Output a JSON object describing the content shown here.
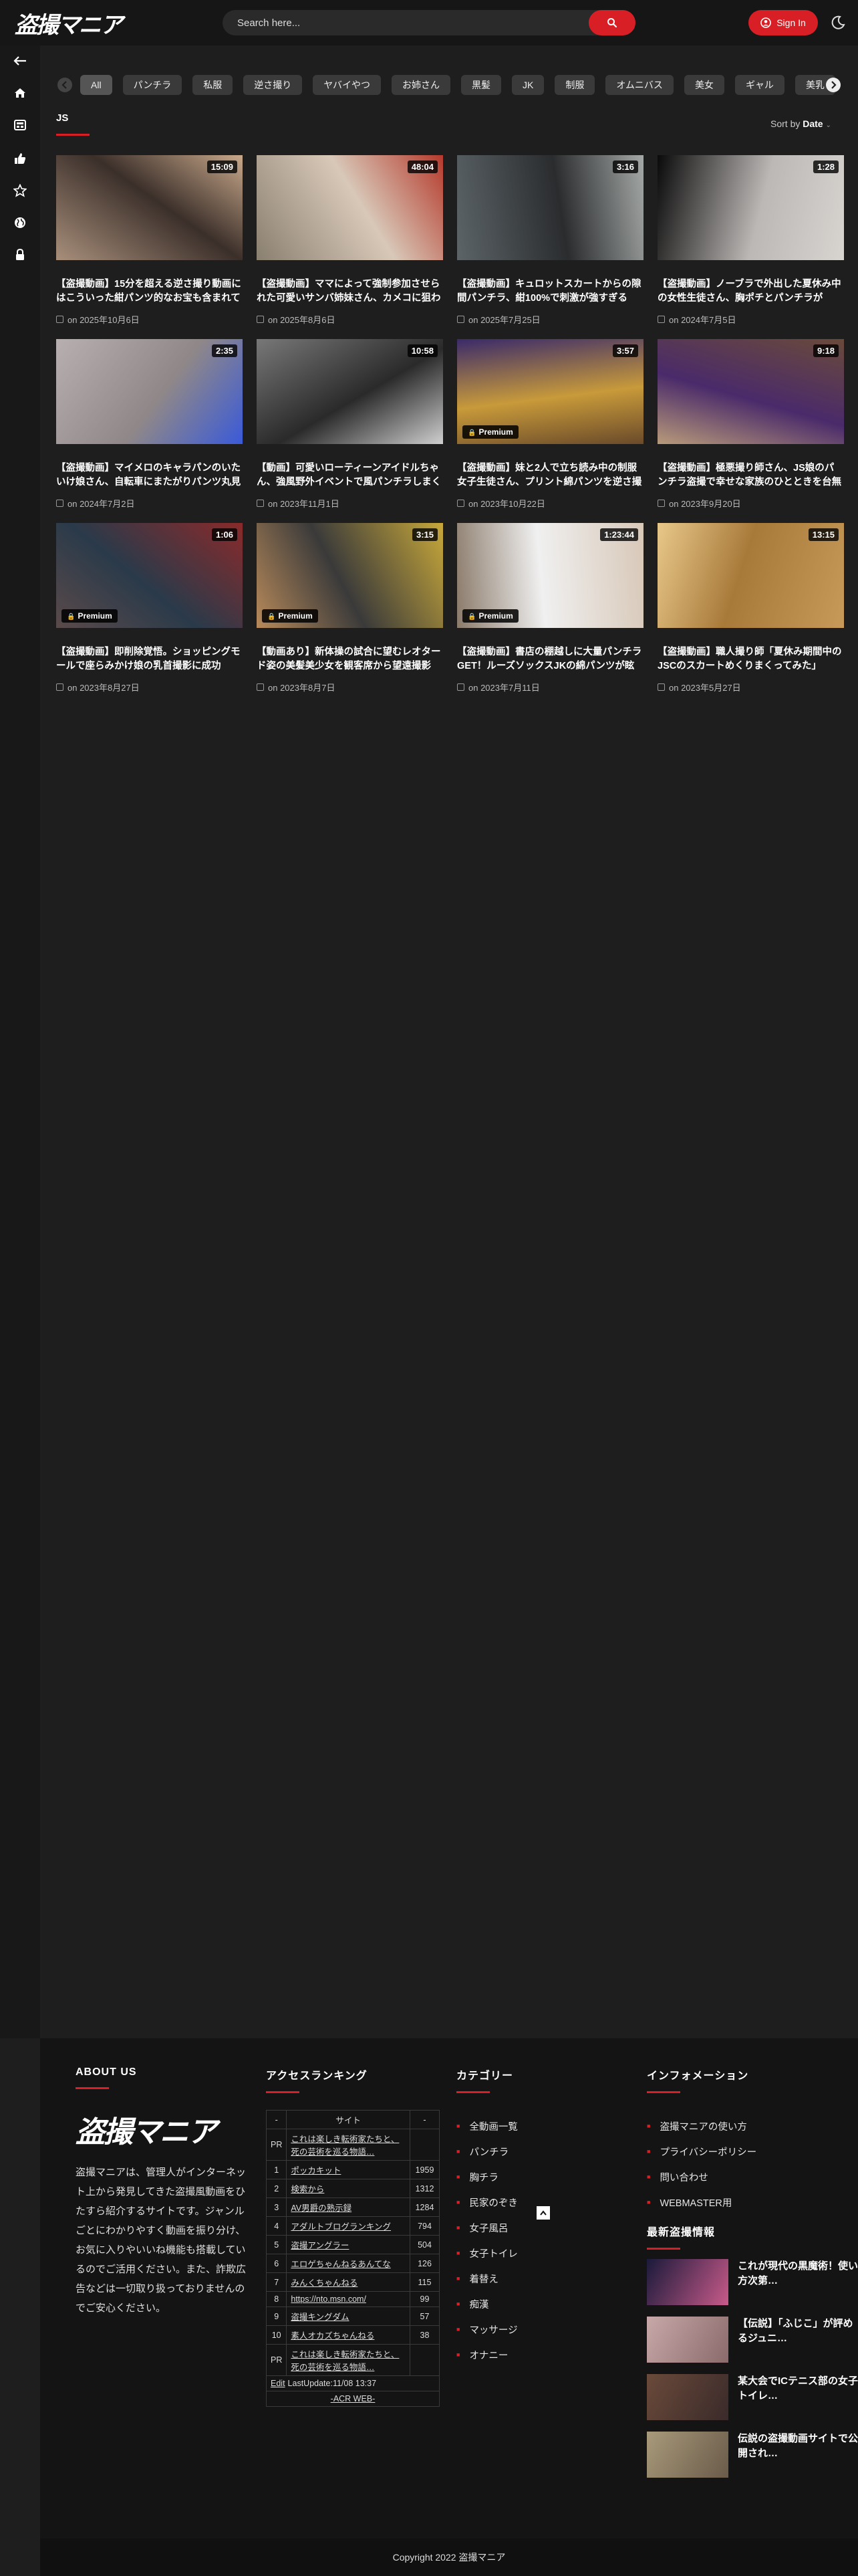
{
  "header": {
    "logo": "盗撮マニア",
    "search_placeholder": "Search here...",
    "signin_label": "Sign In"
  },
  "sidebar": {
    "items": [
      "back-arrow-icon",
      "home-icon",
      "grid-icon",
      "thumbs-up-icon",
      "star-icon",
      "globe-icon",
      "lock-icon"
    ]
  },
  "filters": {
    "chips": [
      "All",
      "パンチラ",
      "私服",
      "逆さ撮り",
      "ヤバイやつ",
      "お姉さん",
      "黒髪",
      "JK",
      "制服",
      "オムニバス",
      "美女",
      "ギャル",
      "美乳"
    ]
  },
  "page": {
    "title": "JS",
    "sort_label": "Sort by",
    "sort_value": "Date"
  },
  "videos": [
    {
      "title": "【盗撮動画】15分を超える逆さ撮り動画にはこういった紺パンツ的なお宝も含まれています",
      "date": "on 2025年10月6日",
      "duration": "15:09",
      "premium": false,
      "colors": [
        "#a88f7b",
        "#3b2f2a",
        "#c9a98b"
      ]
    },
    {
      "title": "【盗撮動画】ママによって強制参加させられた可愛いサンバ姉妹さん、カメコに狙われ",
      "date": "on 2025年8月6日",
      "duration": "48:04",
      "premium": false,
      "colors": [
        "#8a8070",
        "#d8c8b8",
        "#b53a2c"
      ]
    },
    {
      "title": "【盗撮動画】キュロットスカートからの隙間パンチラ、紺100%で刺激が強すぎる",
      "date": "on 2025年7月25日",
      "duration": "3:16",
      "premium": false,
      "colors": [
        "#5c6468",
        "#2a2c2e",
        "#a4a8a6"
      ]
    },
    {
      "title": "【盗撮動画】ノーブラで外出した夏休み中の女性生徒さん、胸ポチとパンチラが",
      "date": "on 2024年7月5日",
      "duration": "1:28",
      "premium": false,
      "colors": [
        "#0a0a0a",
        "#bcb8b6",
        "#d8d4d0"
      ]
    },
    {
      "title": "【盗撮動画】マイメロのキャラパンのいたいけ娘さん、自転車にまたがりパンツ丸見え",
      "date": "on 2024年7月2日",
      "duration": "2:35",
      "premium": false,
      "colors": [
        "#b8b0b0",
        "#908888",
        "#3a5ad8"
      ]
    },
    {
      "title": "【動画】可愛いローティーンアイドルちゃん、強風野外イベントで風パンチラしまくり",
      "date": "on 2023年11月1日",
      "duration": "10:58",
      "premium": false,
      "colors": [
        "#787878",
        "#2a2a2a",
        "#cfcfcf"
      ]
    },
    {
      "title": "【盗撮動画】妹と2人で立ち読み中の制服女子生徒さん、プリント綿パンツを逆さ撮り",
      "date": "on 2023年10月22日",
      "duration": "3:57",
      "premium": true,
      "colors": [
        "#3a2a6a",
        "#c89a3a",
        "#6a4a2a"
      ]
    },
    {
      "title": "【盗撮動画】極悪撮り師さん、JS娘のパンチラ盗撮で幸せな家族のひとときを台無しに",
      "date": "on 2023年9月20日",
      "duration": "9:18",
      "premium": false,
      "colors": [
        "#6a4a3a",
        "#4a2a6a",
        "#b89a7a"
      ]
    },
    {
      "title": "【盗撮動画】即削除覚悟。ショッピングモールで座らみかけ娘の乳首撮影に成功",
      "date": "on 2023年8月27日",
      "duration": "1:06",
      "premium": true,
      "colors": [
        "#8a2a2a",
        "#2a3a4a",
        "#5a4a4a"
      ]
    },
    {
      "title": "【動画あり】新体操の試合に望むレオタード姿の美髪美少女を観客席から望遠撮影",
      "date": "on 2023年8月7日",
      "duration": "3:15",
      "premium": true,
      "colors": [
        "#c8a83a",
        "#3a3a3a",
        "#b88a5a"
      ]
    },
    {
      "title": "【盗撮動画】書店の棚越しに大量パンチラGET！ルーズソックスJKの綿パンツが眩しい",
      "date": "on 2023年7月11日",
      "duration": "1:23:44",
      "premium": true,
      "colors": [
        "#d8c8b8",
        "#f0f0f0",
        "#8a7a6a"
      ]
    },
    {
      "title": "【盗撮動画】職人撮り師「夏休み期間中のJSCのスカートめくりまくってみた」",
      "date": "on 2023年5月27日",
      "duration": "13:15",
      "premium": false,
      "colors": [
        "#c89a5a",
        "#a87a3a",
        "#e8c88a"
      ]
    }
  ],
  "footer": {
    "about": {
      "heading": "ABOUT US",
      "logo": "盗撮マニア",
      "text": "盗撮マニアは、管理人がインターネット上から発見してきた盗撮風動画をひたすら紹介するサイトです。ジャンルごとにわかりやすく動画を振り分け、お気に入りやいいね機能も搭載しているのでご活用ください。また、詐欺広告などは一切取り扱っておりませんのでご安心ください。"
    },
    "ranking": {
      "heading": "アクセスランキング",
      "header_row": [
        "-",
        "サイト",
        "-"
      ],
      "rows": [
        {
          "n": "PR",
          "site": "これは楽しき転術家たちと、死の芸術を巡る物語…",
          "v": ""
        },
        {
          "n": "1",
          "site": "ポッカキット",
          "v": "1959"
        },
        {
          "n": "2",
          "site": "検索から",
          "v": "1312"
        },
        {
          "n": "3",
          "site": "AV男爵の熟示録",
          "v": "1284"
        },
        {
          "n": "4",
          "site": "アダルトブログランキング",
          "v": "794"
        },
        {
          "n": "5",
          "site": "盗撮アングラー",
          "v": "504"
        },
        {
          "n": "6",
          "site": "エロゲちゃんねるあんてな",
          "v": "126"
        },
        {
          "n": "7",
          "site": "みんくちゃんねる",
          "v": "115"
        },
        {
          "n": "8",
          "site": "https://nto.msn.com/",
          "v": "99"
        },
        {
          "n": "9",
          "site": "盗撮キングダム",
          "v": "57"
        },
        {
          "n": "10",
          "site": "素人オカズちゃんねる",
          "v": "38"
        },
        {
          "n": "PR",
          "site": "これは楽しき転術家たちと、死の芸術を巡る物語…",
          "v": ""
        }
      ],
      "edit": "Edit",
      "last_update": "LastUpdate:11/08 13:37",
      "credit": "-ACR WEB-"
    },
    "categories": {
      "heading": "カテゴリー",
      "items": [
        "全動画一覧",
        "パンチラ",
        "胸チラ",
        "民家のぞき",
        "女子風呂",
        "女子トイレ",
        "着替え",
        "痴漢",
        "マッサージ",
        "オナニー"
      ]
    },
    "info": {
      "heading": "インフォメーション",
      "items": [
        "盗撮マニアの使い方",
        "プライバシーポリシー",
        "問い合わせ",
        "WEBMASTER用"
      ],
      "news_heading": "最新盗撮情報",
      "news": [
        {
          "title": "これが現代の黒魔術！使い方次第…",
          "colors": [
            "#1a1a3a",
            "#c85a8a"
          ]
        },
        {
          "title": "【伝説】「ふじこ」が評めるジュニ…",
          "colors": [
            "#c8a8a8",
            "#8a6a6a"
          ]
        },
        {
          "title": "某大会でICテニス部の女子トイレ…",
          "colors": [
            "#6a4a3a",
            "#3a2a2a"
          ]
        },
        {
          "title": "伝説の盗撮動画サイトで公開され…",
          "colors": [
            "#a89a7a",
            "#6a5a4a"
          ]
        }
      ]
    },
    "copyright": "Copyright 2022 盗撮マニア"
  }
}
